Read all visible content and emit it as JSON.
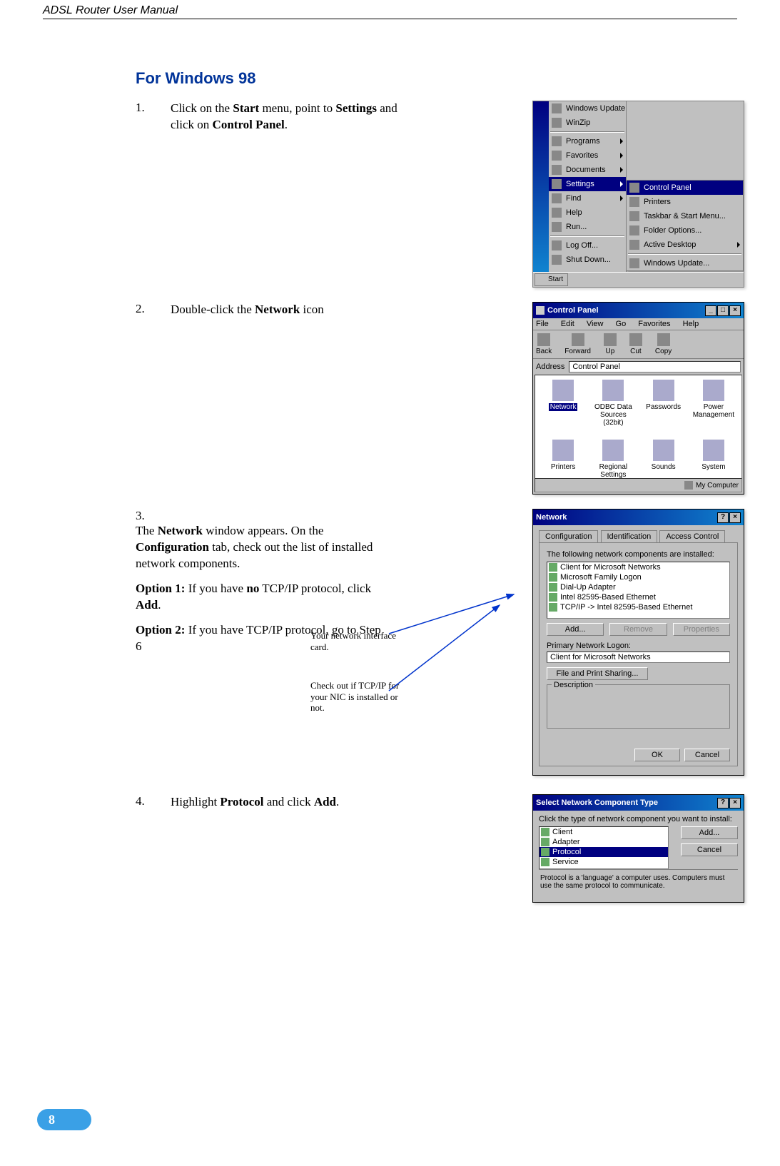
{
  "header": {
    "title": "ADSL Router User Manual"
  },
  "section": {
    "title": "For Windows 98"
  },
  "page_number": "8",
  "steps": {
    "s1": {
      "num": "1.",
      "text_parts": [
        "Click on the ",
        " menu, point to ",
        " and click on ",
        "."
      ],
      "bold": {
        "a": "Start",
        "b": "Settings",
        "c": "Control Panel"
      }
    },
    "s2": {
      "num": "2.",
      "text_parts": [
        "Double-click the ",
        " icon"
      ],
      "bold": {
        "a": "Network"
      }
    },
    "s3": {
      "num": "3.",
      "text_parts": [
        "The ",
        " window appears. On the ",
        " tab, check out the list of installed network components."
      ],
      "bold": {
        "a": "Network",
        "b": "Configuration"
      },
      "opt1": {
        "label": "Option 1:",
        "mid1": " If you have ",
        "bold_no": "no",
        "mid2": " TCP/IP protocol, click ",
        "bold_add": "Add",
        "end": "."
      },
      "opt2": {
        "label": "Option 2:",
        "text": " If you have TCP/IP protocol, go to Step 6"
      },
      "annot1": "Your network interface card.",
      "annot2": "Check out if TCP/IP for your NIC is installed or not."
    },
    "s4": {
      "num": "4.",
      "text_parts": [
        "Highlight ",
        " and click ",
        "."
      ],
      "bold": {
        "a": "Protocol",
        "b": "Add"
      }
    }
  },
  "startmenu": {
    "col1": [
      "Windows Update",
      "WinZip",
      "Programs",
      "Favorites",
      "Documents",
      "Settings",
      "Find",
      "Help",
      "Run...",
      "Log Off...",
      "Shut Down..."
    ],
    "col2": [
      "Control Panel",
      "Printers",
      "Taskbar & Start Menu...",
      "Folder Options...",
      "Active Desktop",
      "Windows Update..."
    ],
    "start_button": "Start"
  },
  "cpwin": {
    "title": "Control Panel",
    "menu": [
      "File",
      "Edit",
      "View",
      "Go",
      "Favorites",
      "Help"
    ],
    "toolbar": {
      "back": "Back",
      "forward": "Forward",
      "up": "Up",
      "cut": "Cut",
      "copy": "Copy"
    },
    "address_label": "Address",
    "address_value": "Control Panel",
    "icons": [
      "Network",
      "ODBC Data Sources (32bit)",
      "Passwords",
      "Power Management",
      "Printers",
      "Regional Settings",
      "Sounds",
      "System"
    ],
    "status": "My Computer"
  },
  "netdlg": {
    "title": "Network",
    "tabs": [
      "Configuration",
      "Identification",
      "Access Control"
    ],
    "list_label": "The following network components are installed:",
    "list_items": [
      "Client for Microsoft Networks",
      "Microsoft Family Logon",
      "Dial-Up Adapter",
      "Intel 82595-Based Ethernet",
      "TCP/IP -> Intel  82595-Based Ethernet"
    ],
    "btn_add": "Add...",
    "btn_remove": "Remove",
    "btn_props": "Properties",
    "logon_label": "Primary Network Logon:",
    "logon_value": "Client for Microsoft Networks",
    "fps_btn": "File and Print Sharing...",
    "desc_label": "Description",
    "ok": "OK",
    "cancel": "Cancel"
  },
  "seldlg": {
    "title": "Select Network Component Type",
    "prompt": "Click the type of network component you want to install:",
    "items": [
      "Client",
      "Adapter",
      "Protocol",
      "Service"
    ],
    "btn_add": "Add...",
    "btn_cancel": "Cancel",
    "desc": "Protocol is a 'language' a computer uses. Computers must use the same protocol to communicate."
  }
}
